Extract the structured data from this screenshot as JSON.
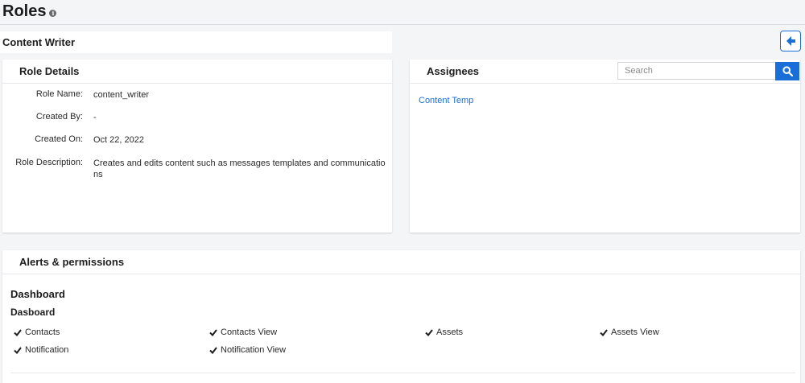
{
  "page": {
    "title": "Roles"
  },
  "role": {
    "name_heading": "Content Writer"
  },
  "role_details": {
    "title": "Role Details",
    "rows": [
      {
        "label": "Role Name:",
        "value": "content_writer"
      },
      {
        "label": "Created By:",
        "value": "-"
      },
      {
        "label": "Created On:",
        "value": "Oct 22, 2022"
      },
      {
        "label": "Role Description:",
        "value": "Creates and edits content such as messages templates and communications"
      }
    ]
  },
  "assignees": {
    "title": "Assignees",
    "search_placeholder": "Search",
    "items": [
      "Content Temp"
    ]
  },
  "alerts": {
    "title": "Alerts & permissions",
    "section": "Dashboard",
    "subsection": "Dasboard",
    "permissions": [
      "Contacts",
      "Contacts View",
      "Assets",
      "Assets View",
      "Notification",
      "Notification View"
    ]
  },
  "colors": {
    "accent": "#1a6ed8"
  },
  "icons": {
    "info": "info-icon",
    "back": "arrow-left-icon",
    "search": "search-icon",
    "check": "check-icon"
  }
}
